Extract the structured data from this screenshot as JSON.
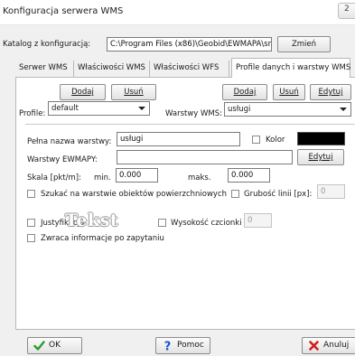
{
  "window": {
    "title": "Konfiguracja serwera WMS",
    "title_button": "2"
  },
  "config_dir": {
    "label": "Katalog z konfiguracją:",
    "value": "C:\\Program Files (x86)\\Geobid\\EWMAPA\\srv",
    "change_button": "Zmień"
  },
  "tabs": [
    {
      "label": "Serwer WMS",
      "active": false
    },
    {
      "label": "Właściwości WMS",
      "active": false
    },
    {
      "label": "Właściwości WFS",
      "active": false
    },
    {
      "label": "Profile danych i warstwy WMS",
      "active": true
    }
  ],
  "profiles": {
    "add_button": "Dodaj",
    "remove_button": "Usuń",
    "label": "Profile:",
    "selected": "default"
  },
  "wms_layers": {
    "add_button": "Dodaj",
    "remove_button": "Usuń",
    "edit_button": "Edytuj",
    "label": "Warstwy WMS:",
    "selected": "usługi"
  },
  "layer": {
    "full_name_label": "Pełna nazwa warstwy:",
    "full_name_value": "usługi",
    "color_label": "Kolor",
    "color_value": "#000000",
    "ewmapa_label": "Warstwy EWMAPY:",
    "ewmapa_value": "",
    "edit_button": "Edytuj",
    "scale_label": "Skala [pkt/m]:",
    "min_label": "min.",
    "min_value": "0.000",
    "max_label": "maks.",
    "max_value": "0.000",
    "search_label": "Szukać na warstwie obiektów powierzchniowych",
    "line_width_label": "Grubość linii [px]:",
    "line_width_value": "0",
    "justify_label": "Justyfikacja:",
    "preview_text": "Tekst",
    "font_height_label": "Wysokość czcionki [px]:",
    "font_height_value": "0",
    "returns_info_label": "Zwraca informacje po zapytaniu"
  },
  "footer": {
    "ok": "OK",
    "help": "Pomoc",
    "cancel": "Anuluj"
  }
}
